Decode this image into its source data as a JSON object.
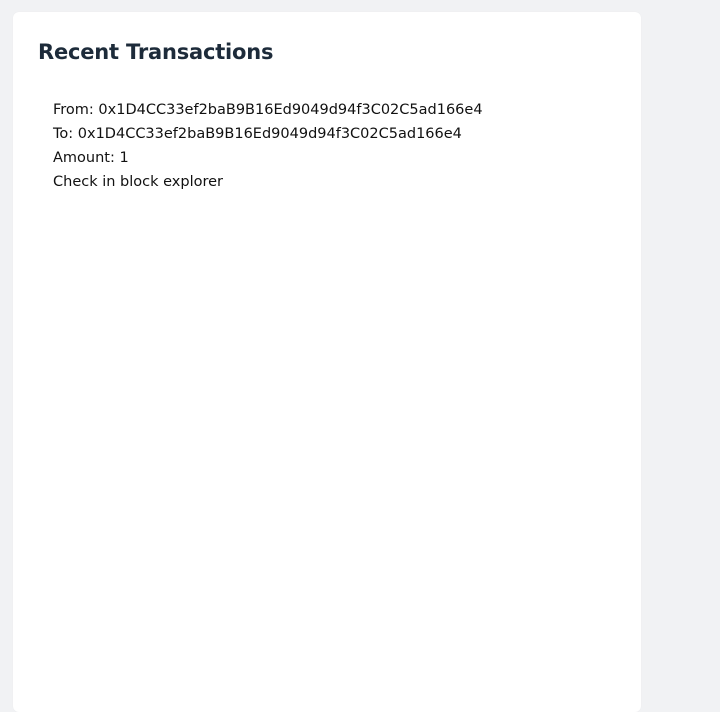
{
  "panel": {
    "title": "Recent Transactions"
  },
  "transactions": [
    {
      "from_label": "From: ",
      "from": "0x1D4CC33ef2baB9B16Ed9049d94f3C02C5ad166e4",
      "to_label": "To: ",
      "to": "0x1D4CC33ef2baB9B16Ed9049d94f3C02C5ad166e4",
      "amount_label": "Amount: ",
      "amount": "1",
      "explorer_link": "Check in block explorer"
    }
  ]
}
